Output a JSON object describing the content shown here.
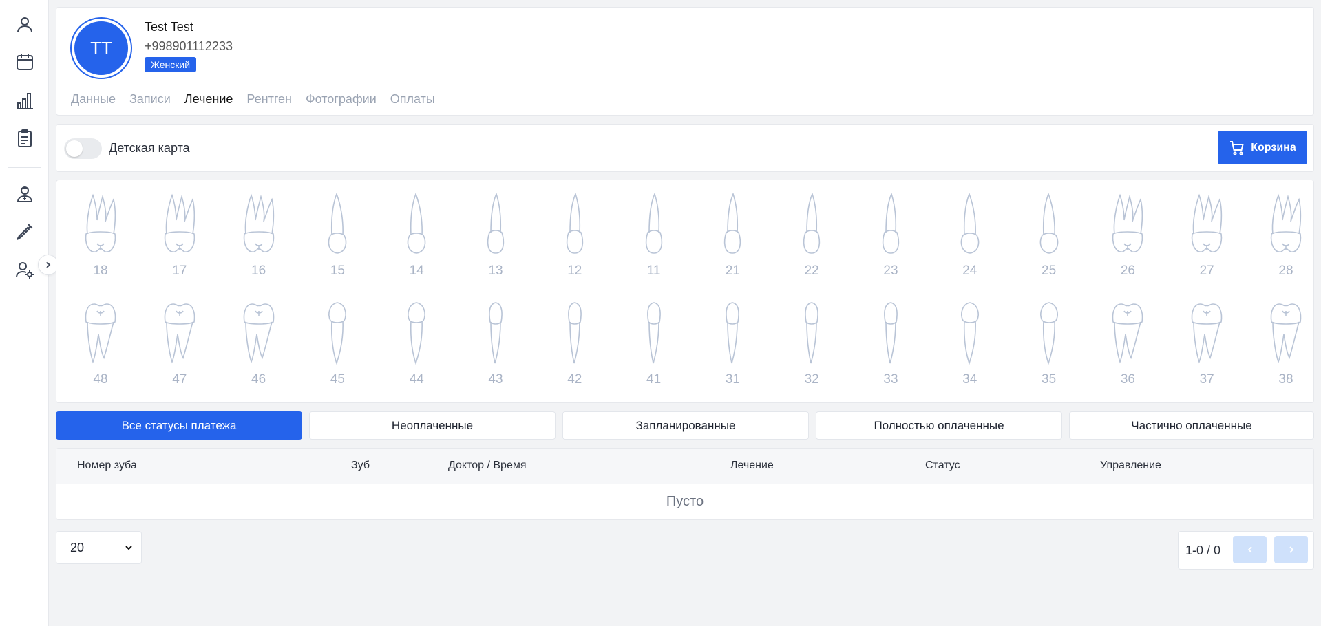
{
  "sidebar": {
    "icons": [
      "user-icon",
      "calendar-icon",
      "bar-chart-icon",
      "clipboard-icon",
      "doctor-icon",
      "syringe-icon",
      "user-settings-icon"
    ],
    "expand_icon": "chevron-right-icon"
  },
  "patient": {
    "initials": "TT",
    "name": "Test Test",
    "phone": "+998901112233",
    "gender": "Женский"
  },
  "tabs": [
    {
      "label": "Данные",
      "active": false
    },
    {
      "label": "Записи",
      "active": false
    },
    {
      "label": "Лечение",
      "active": true
    },
    {
      "label": "Рентген",
      "active": false
    },
    {
      "label": "Фотографии",
      "active": false
    },
    {
      "label": "Оплаты",
      "active": false
    }
  ],
  "toolbar": {
    "child_card_label": "Детская карта",
    "child_card_on": false,
    "cart_label": "Корзина"
  },
  "teeth": {
    "upper": [
      "18",
      "17",
      "16",
      "15",
      "14",
      "13",
      "12",
      "11",
      "21",
      "22",
      "23",
      "24",
      "25",
      "26",
      "27",
      "28"
    ],
    "lower": [
      "48",
      "47",
      "46",
      "45",
      "44",
      "43",
      "42",
      "41",
      "31",
      "32",
      "33",
      "34",
      "35",
      "36",
      "37",
      "38"
    ]
  },
  "filters": [
    {
      "label": "Все статусы платежа",
      "active": true
    },
    {
      "label": "Неоплаченные",
      "active": false
    },
    {
      "label": "Запланированные",
      "active": false
    },
    {
      "label": "Полностью оплаченные",
      "active": false
    },
    {
      "label": "Частично оплаченные",
      "active": false
    }
  ],
  "table": {
    "headers": [
      "Номер зуба",
      "Зуб",
      "Доктор / Время",
      "Лечение",
      "Статус",
      "Управление"
    ],
    "empty_text": "Пусто"
  },
  "footer": {
    "page_size": "20",
    "range_text": "1-0 / 0"
  },
  "colors": {
    "accent": "#2563eb",
    "tooth_outline": "#b9c4d6",
    "pager_disabled": "#cfe1fb"
  }
}
